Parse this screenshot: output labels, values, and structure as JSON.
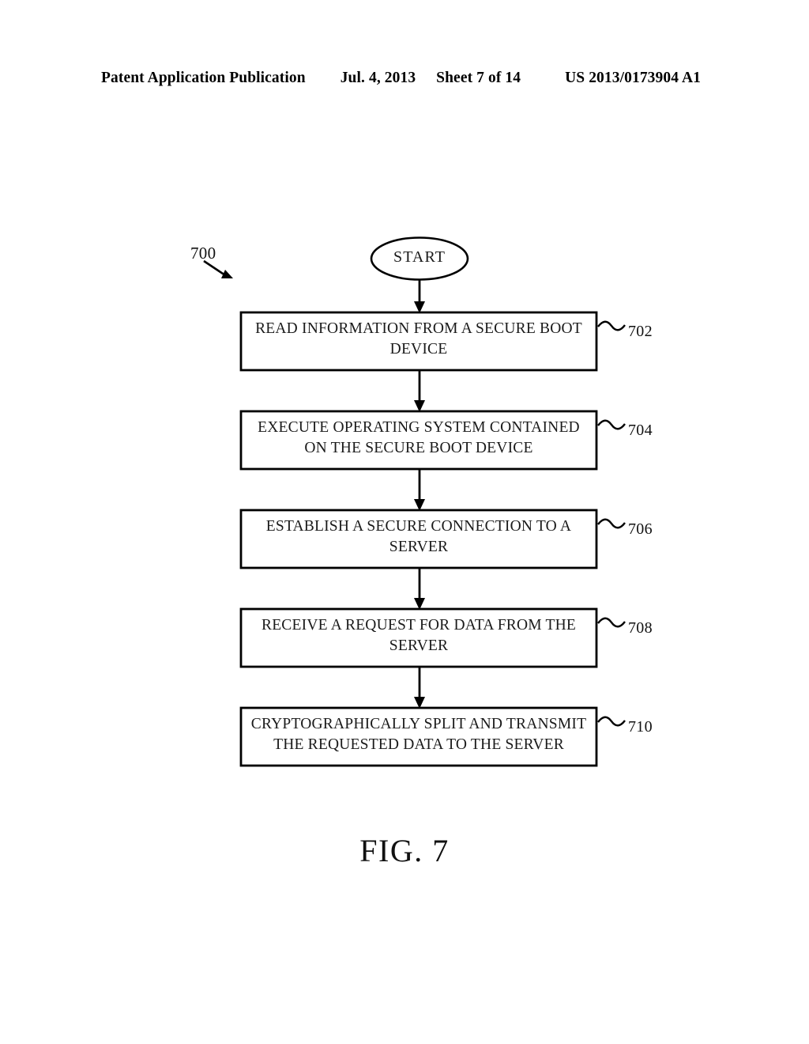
{
  "header": {
    "publication": "Patent Application Publication",
    "date": "Jul. 4, 2013",
    "sheet": "Sheet 7 of 14",
    "patent_number": "US 2013/0173904 A1"
  },
  "figure": {
    "caption": "FIG. 7",
    "diagram_reference": "700",
    "start_label": "START",
    "steps": [
      {
        "ref": "702",
        "text": "READ INFORMATION FROM A SECURE BOOT DEVICE"
      },
      {
        "ref": "704",
        "text": "EXECUTE OPERATING SYSTEM CONTAINED ON THE SECURE BOOT DEVICE"
      },
      {
        "ref": "706",
        "text": "ESTABLISH A SECURE CONNECTION TO A SERVER"
      },
      {
        "ref": "708",
        "text": "RECEIVE A REQUEST FOR DATA FROM THE SERVER"
      },
      {
        "ref": "710",
        "text": "CRYPTOGRAPHICALLY SPLIT AND TRANSMIT THE REQUESTED DATA TO THE SERVER"
      }
    ]
  },
  "colors": {
    "ink": "#000000",
    "text": "#1a1a1a",
    "paper": "#ffffff"
  }
}
